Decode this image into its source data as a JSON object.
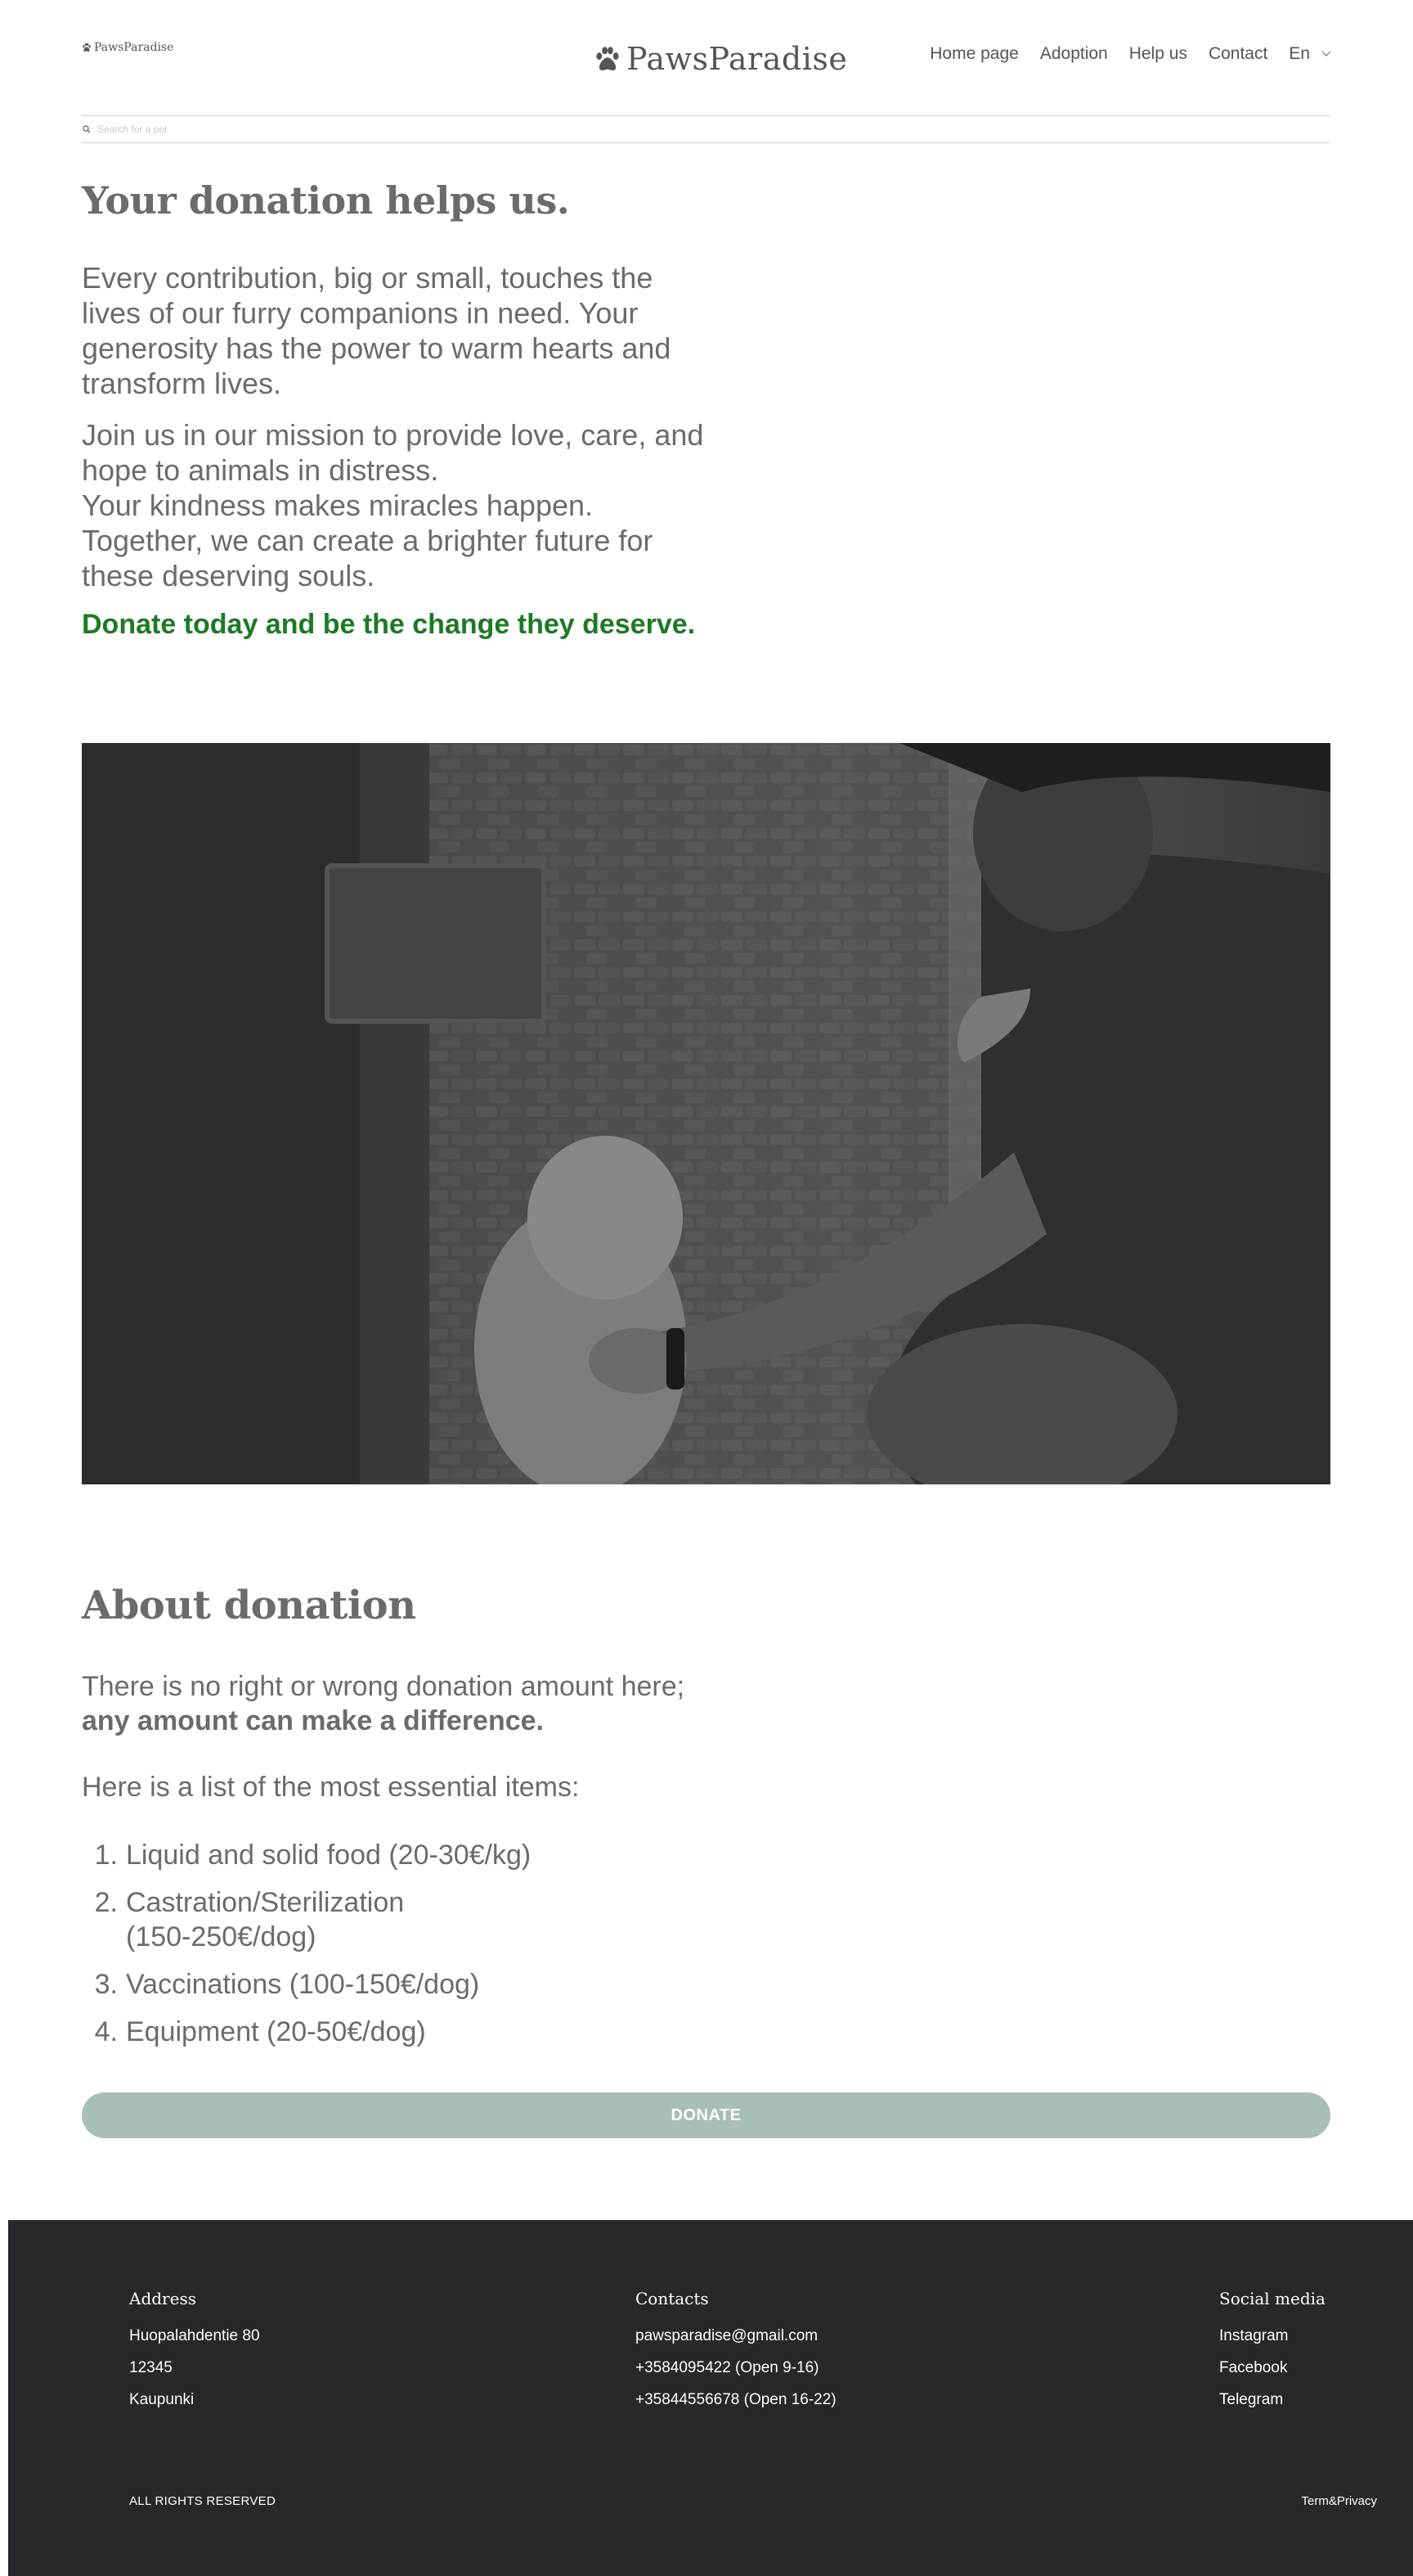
{
  "header": {
    "small_logo": "PawsParadise",
    "logo": "PawsParadise",
    "nav": [
      "Home page",
      "Adoption",
      "Help us",
      "Contact"
    ],
    "language": "En",
    "search_placeholder": "Search for a pet"
  },
  "intro": {
    "title": "Your donation helps us.",
    "paragraph1": "Every contribution, big or small, touches the lives of our furry companions in need. Your generosity has the power to warm hearts and transform lives.",
    "paragraph2": "Join us in our mission to provide love, care, and hope to animals in distress.",
    "paragraph3": "Your kindness makes miracles happen. Together, we can create a brighter future for these deserving souls.",
    "cta": "Donate today and be the change they deserve."
  },
  "about": {
    "title": "About donation",
    "text_before": "There is no right or wrong donation amount here;",
    "text_bold": "any amount can make a difference.",
    "list_intro": "Here is a list of the most essential items:",
    "items": [
      "Liquid and solid food (20-30€/kg)",
      "Castration/Sterilization (150-250€/dog)",
      "Vaccinations (100-150€/dog)",
      "Equipment (20-50€/dog)"
    ],
    "donate_label": "DONATE"
  },
  "footer": {
    "address": {
      "title": "Address",
      "lines": [
        "Huopalahdentie 80",
        "12345",
        "Kaupunki"
      ]
    },
    "contacts": {
      "title": "Contacts",
      "lines": [
        "pawsparadise@gmail.com",
        "+3584095422 (Open 9-16)",
        "+35844556678 (Open 16-22)"
      ]
    },
    "social": {
      "title": "Social media",
      "links": [
        "Instagram",
        "Facebook",
        "Telegram"
      ]
    },
    "rights": "ALL RIGHTS RESERVED",
    "terms": "Term&Privacy"
  },
  "colors": {
    "text": "#6b6b6b",
    "cta_green": "#1d7a23",
    "button": "#a7bfb5",
    "footer_bg": "#27272c"
  },
  "icons": [
    "paw-icon",
    "search-icon",
    "chevron-down-icon"
  ]
}
